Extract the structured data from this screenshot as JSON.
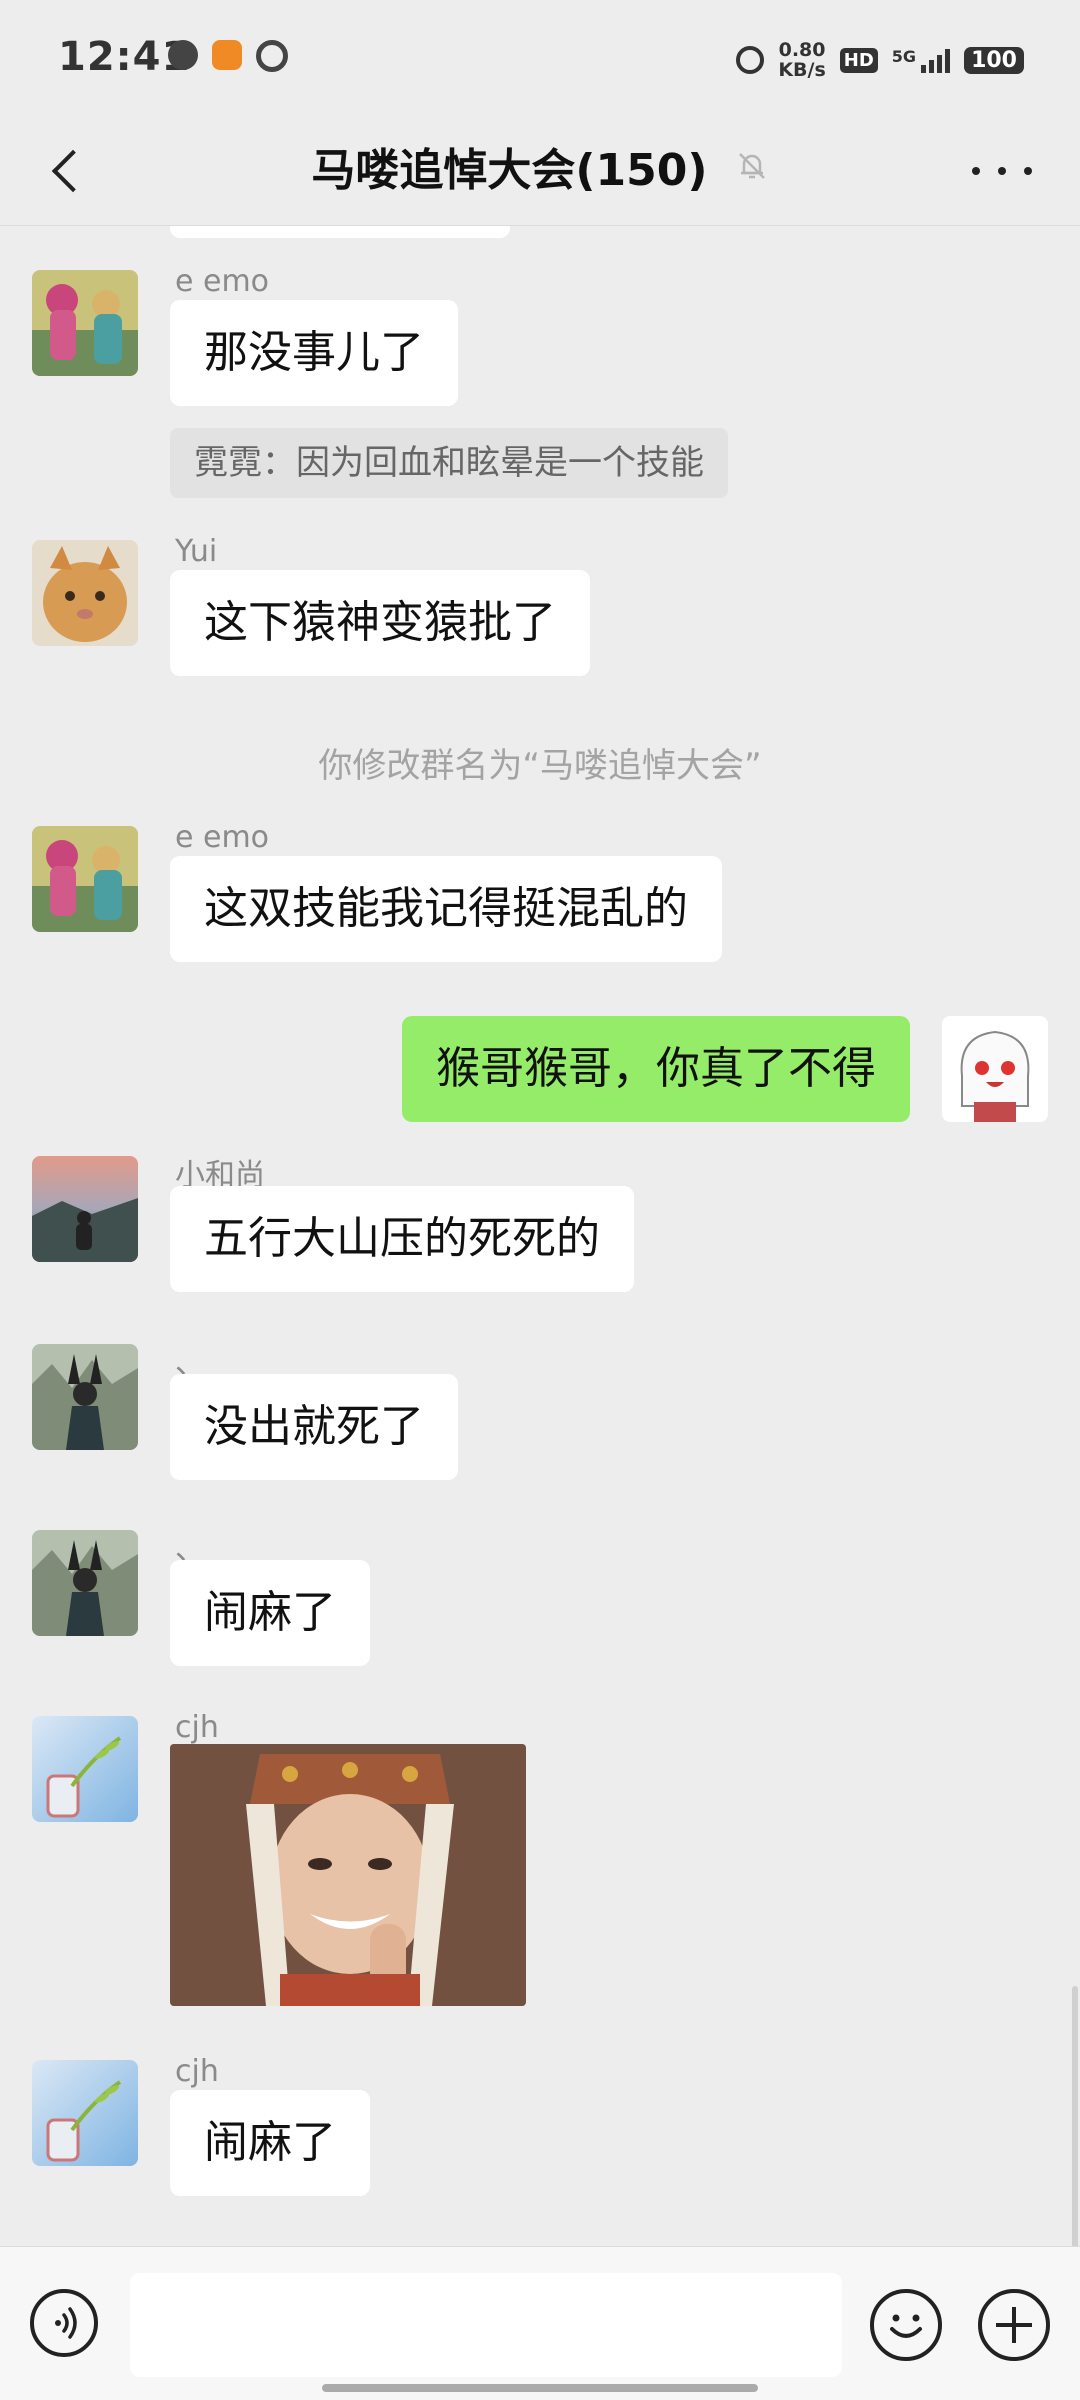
{
  "status_bar": {
    "time": "12:41",
    "net_speed_value": "0.80",
    "net_speed_unit": "KB/s",
    "hd_label": "HD",
    "network": "5G",
    "battery": "100"
  },
  "header": {
    "title": "马喽追悼大会(150)"
  },
  "messages": [
    {
      "sender": "e emo",
      "text": "那没事儿了",
      "quote": "霓霓：因为回血和眩晕是一个技能"
    },
    {
      "sender": "Yui",
      "text": "这下猿神变猿批了"
    },
    {
      "system": "你修改群名为“马喽追悼大会”"
    },
    {
      "sender": "e emo",
      "text": "这双技能我记得挺混乱的"
    },
    {
      "sender": "",
      "text": "猴哥猴哥，你真了不得",
      "mine": true
    },
    {
      "sender": "小和尚",
      "text": "五行大山压的死死的"
    },
    {
      "sender": "、",
      "text": "没出就死了"
    },
    {
      "sender": "、",
      "text": "闹麻了"
    },
    {
      "sender": "cjh",
      "image": true
    },
    {
      "sender": "cjh",
      "text": "闹麻了"
    }
  ],
  "colors": {
    "background": "#ededed",
    "my_bubble": "#95ec69",
    "other_bubble": "#ffffff"
  }
}
